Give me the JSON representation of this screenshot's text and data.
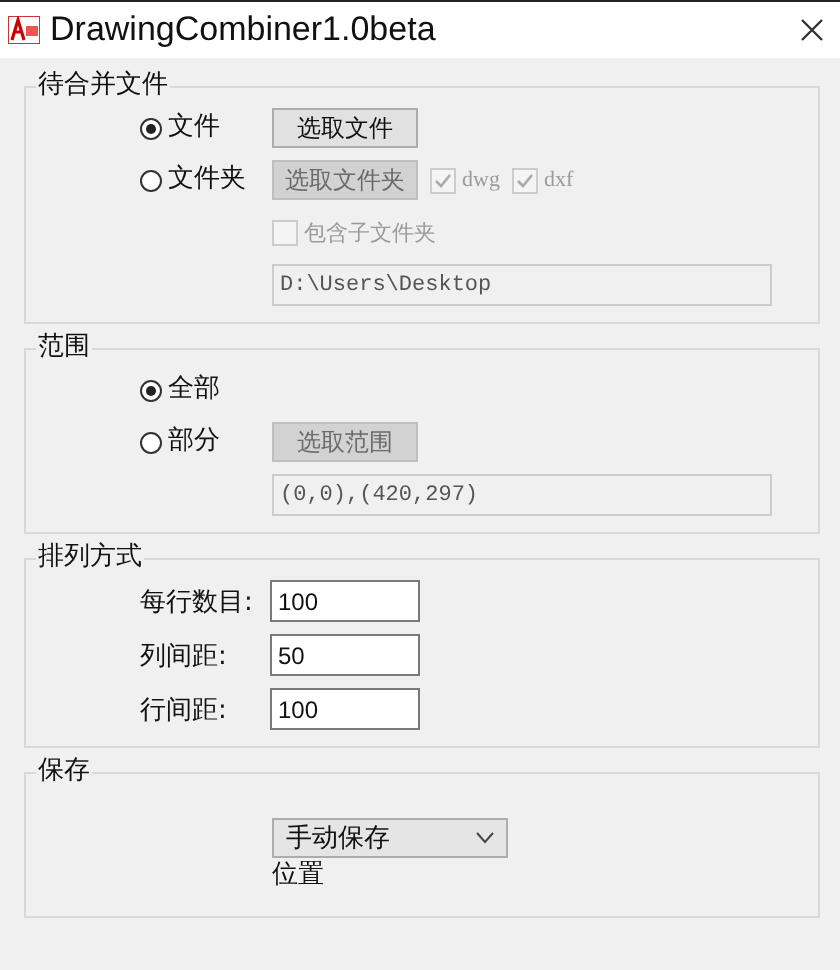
{
  "window": {
    "title": "DrawingCombiner1.0beta"
  },
  "files_group": {
    "title": "待合并文件",
    "options": [
      {
        "label": "文件",
        "selected": true,
        "button": "选取文件",
        "button_disabled": false
      },
      {
        "label": "文件夹",
        "selected": false,
        "button": "选取文件夹",
        "button_disabled": true
      }
    ],
    "types": [
      {
        "label": "dwg",
        "checked": true,
        "disabled": true
      },
      {
        "label": "dxf",
        "checked": true,
        "disabled": true
      }
    ],
    "subfolders": {
      "label": "包含子文件夹",
      "checked": false,
      "disabled": true
    },
    "path": {
      "value": "D:\\Users\\Desktop",
      "disabled": true
    }
  },
  "range_group": {
    "title": "范围",
    "options": [
      {
        "label": "全部",
        "selected": true
      },
      {
        "label": "部分",
        "selected": false,
        "button": "选取范围",
        "button_disabled": true
      }
    ],
    "extent": {
      "value": "(0,0),(420,297)",
      "disabled": true
    }
  },
  "layout_group": {
    "title": "排列方式",
    "fields": [
      {
        "label": "每行数目:",
        "value": "100"
      },
      {
        "label": "列间距:",
        "value": "50"
      },
      {
        "label": "行间距:",
        "value": "100"
      }
    ]
  },
  "save_group": {
    "title": "保存",
    "dropdown": {
      "value": "手动保存"
    },
    "location_label": "位置"
  }
}
